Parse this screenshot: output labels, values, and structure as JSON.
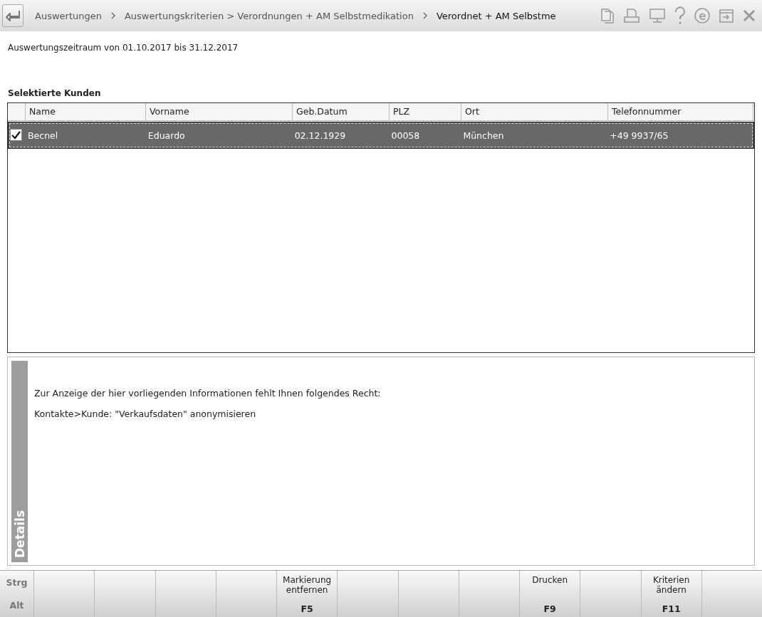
{
  "toolbar": {
    "breadcrumbs": [
      {
        "label": "Auswertungen",
        "current": false
      },
      {
        "label": "Auswertungskriterien > Verordnungen + AM Selbstmedikation",
        "current": false
      },
      {
        "label": "Verordnet + AM Selbstme",
        "current": true
      }
    ]
  },
  "period": "Auswertungszeitraum von 01.10.2017 bis 31.12.2017",
  "table": {
    "title": "Selektierte Kunden",
    "columns": [
      "Name",
      "Vorname",
      "Geb.Datum",
      "PLZ",
      "Ort",
      "Telefonnummer"
    ],
    "rows": [
      {
        "checked": true,
        "selected": true,
        "cells": [
          "Becnel",
          "Eduardo",
          "02.12.1929",
          "00058",
          "München",
          "+49 9937/65"
        ]
      }
    ]
  },
  "details": {
    "tab": "Details",
    "lines": [
      "Zur Anzeige der hier vorliegenden Informationen fehlt Ihnen folgendes Recht:",
      "Kontakte>Kunde: \"Verkaufsdaten\" anonymisieren"
    ]
  },
  "function_bar": {
    "modifiers": [
      "Strg",
      "Alt"
    ],
    "keys": [
      {
        "kind": "blank"
      },
      {
        "kind": "blank"
      },
      {
        "kind": "blank"
      },
      {
        "kind": "blank"
      },
      {
        "kind": "labeled",
        "label": "Markierung entfernen",
        "key": "F5"
      },
      {
        "kind": "blank"
      },
      {
        "kind": "blank"
      },
      {
        "kind": "blank"
      },
      {
        "kind": "labeled",
        "label": "Drucken",
        "key": "F9"
      },
      {
        "kind": "blank"
      },
      {
        "kind": "labeled",
        "label": "Kriterien ändern",
        "key": "F11"
      },
      {
        "kind": "blank"
      }
    ]
  }
}
